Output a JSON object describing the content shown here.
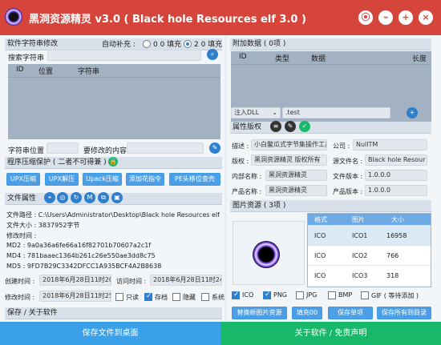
{
  "app": {
    "title": "黑洞资源精灵 v3.0 ( Black hole Resources elf 3.0 )",
    "title_controls": [
      "⦿",
      "⌁",
      "+",
      "×"
    ]
  },
  "left": {
    "section_string_edit": "软件字符串修改",
    "auto_pad_label": "自动补充 :",
    "pad_options": [
      {
        "label": "0 0 填充",
        "selected": false
      },
      {
        "label": "2 0 填充",
        "selected": true
      }
    ],
    "search_label": "搜索字符串 :",
    "search_value": "",
    "table_headers": [
      "ID",
      "位置",
      "字符串"
    ],
    "string_position_label": "字符串位置 :",
    "string_position_value": "",
    "content_label": "要修改的内容 :",
    "content_value": "",
    "section_protect": "程序压缩保护 ( 二者不可得兼 )",
    "protect_buttons": [
      "UPX压缩",
      "UPX解压",
      "Upack压缩",
      "添加花指令",
      "PE头移位查壳"
    ],
    "section_file_attr": "文件属性",
    "file_info": [
      "文件路径 : C:\\Users\\Administrator\\Desktop\\Black hole Resources elf",
      "文件大小 : 3837952字节",
      "修改时间 :",
      "MD2 : 9a0a36a6fe66a16f82701b70607a2c1f",
      "MD4 : 781baaec1364b261c26e550ae3dd8c75",
      "MD5 : 9FD7B29C3342DFCC1A935BCF4A2B8638"
    ],
    "create_time_label": "创建时间 :",
    "create_time_value": "2018年6月28日11时20分",
    "access_time_label": "访问时间 :",
    "access_time_value": "2018年6月28日11时24分",
    "modify_time_label": "修改时间 :",
    "modify_time_value": "2018年6月28日11时25分",
    "checkboxes": [
      {
        "label": "只读",
        "checked": false
      },
      {
        "label": "存档",
        "checked": true
      },
      {
        "label": "隐藏",
        "checked": false
      },
      {
        "label": "系统",
        "checked": false
      }
    ],
    "section_save": "保存 / 关于软件"
  },
  "right": {
    "section_extra_data": "附加数据 ( 0项 )",
    "table_headers": [
      "ID",
      "类型",
      "数据",
      "长度"
    ],
    "dll_select": "注入DLL",
    "dll_value": ".test",
    "section_attr": "属性版权",
    "attr_rows": [
      {
        "k1": "描述 :",
        "v1": "小白鳖瓜式字节集操作工具",
        "k2": "公司 :",
        "v2": "NullTM"
      },
      {
        "k1": "版权 :",
        "v1": "黑洞资源精灵 版权所有",
        "k2": "源文件名 :",
        "v2": "Black hole Resour"
      },
      {
        "k1": "内部名称 :",
        "v1": "黑洞资源精灵",
        "k2": "文件版本 :",
        "v2": "1.0.0.0"
      },
      {
        "k1": "产品名称 :",
        "v1": "黑洞资源精灵",
        "k2": "产品版本 :",
        "v2": "1.0.0.0"
      }
    ],
    "section_images": "图片资源 ( 3项 )",
    "image_headers": [
      "格式",
      "图片",
      "大小"
    ],
    "image_rows": [
      {
        "format": "ICO",
        "name": "ICO1",
        "size": "16958"
      },
      {
        "format": "ICO",
        "name": "ICO2",
        "size": "766"
      },
      {
        "format": "ICO",
        "name": "ICO3",
        "size": "318"
      }
    ],
    "image_filters": [
      {
        "label": "ICO",
        "checked": true
      },
      {
        "label": "PNG",
        "checked": true
      },
      {
        "label": "JPG",
        "checked": false
      },
      {
        "label": "BMP",
        "checked": false
      },
      {
        "label": "GIF ( 等待添加 )",
        "checked": false
      }
    ],
    "image_buttons": [
      "替换新图片资源",
      "填充00",
      "保存单项",
      "保存所有到目录"
    ]
  },
  "bottom": {
    "save_to_desktop": "保存文件到桌面",
    "about": "关于软件 / 免责声明"
  },
  "colors": {
    "title_bar": "#d6453b",
    "button_blue": "#4c9fe6",
    "bottom_left": "#3aa0e8",
    "bottom_right": "#18b86a"
  }
}
